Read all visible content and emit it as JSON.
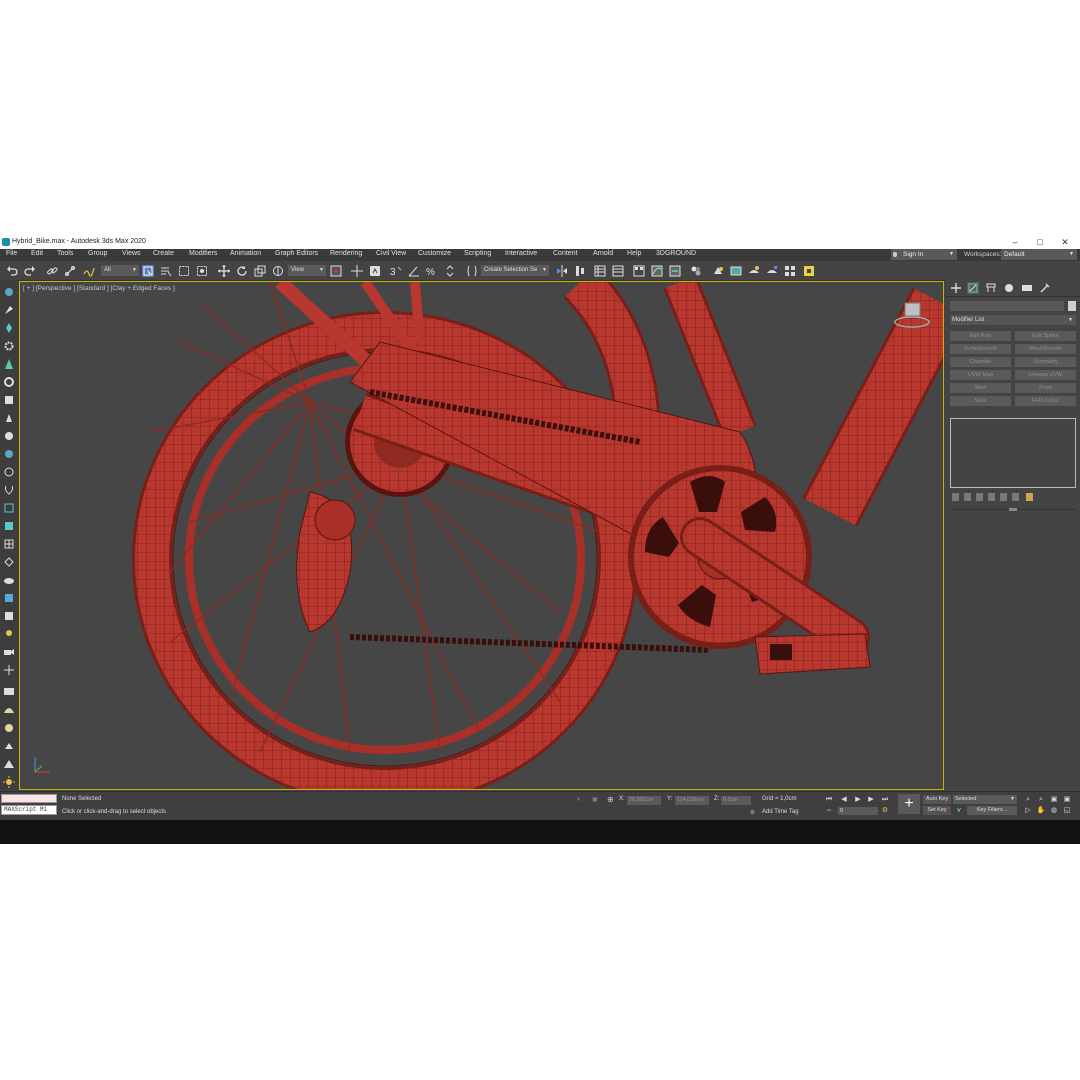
{
  "window": {
    "title": "Hybrid_Bike.max - Autodesk 3ds Max 2020",
    "controls": [
      "–",
      "□",
      "✕"
    ]
  },
  "menu": {
    "items": [
      "File",
      "Edit",
      "Tools",
      "Group",
      "Views",
      "Create",
      "Modifiers",
      "Animation",
      "Graph Editors",
      "Rendering",
      "Civil View",
      "Customize",
      "Scripting",
      "Interactive",
      "Content",
      "Arnold",
      "Help",
      "3DGROUND"
    ],
    "sign_in": "Sign In",
    "workspaces_label": "Workspaces:",
    "workspace_value": "Default"
  },
  "toolbar": {
    "filter_value": "All",
    "coord_value": "View",
    "selection_set_placeholder": "Create Selection Se"
  },
  "viewport": {
    "label": "[ + ] [Perspective ] [Standard ] [Clay + Edged Faces ]",
    "model_color": "#b8372e",
    "wire_color": "#5a1410",
    "background_color": "#464646",
    "active_border_color": "#c8b400"
  },
  "command_panel": {
    "modifier_list": "Modifier List",
    "modifier_buttons": [
      "Edit Poly",
      "Edit Spline",
      "TurboSmooth",
      "MeshSmooth",
      "Chamfer",
      "Symmetry",
      "UVW Map",
      "Unwrap UVW",
      "Shell",
      "Push",
      "Slice",
      "FFD 2x2x2"
    ]
  },
  "status": {
    "maxscript": "MAXScript Mi",
    "selection": "None Selected",
    "prompt": "Click or click-and-drag to select objects",
    "x_label": "X:",
    "x_value": "26,992cm",
    "y_label": "Y:",
    "y_value": "114,016cm",
    "z_label": "Z:",
    "z_value": "0,0cm",
    "grid": "Grid = 1,0cm",
    "add_time_tag": "Add Time Tag",
    "auto_key": "Auto Key",
    "set_key": "Set Key",
    "selected": "Selected",
    "key_filters": "Key Filters...",
    "frame": "0"
  }
}
